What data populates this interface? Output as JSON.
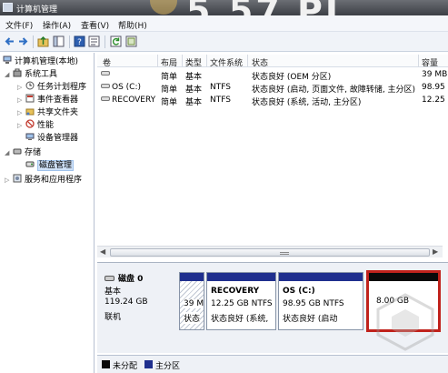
{
  "window": {
    "title": "计算机管理",
    "overlay_clock": "5.57 PI"
  },
  "menu": [
    "文件(F)",
    "操作(A)",
    "查看(V)",
    "帮助(H)"
  ],
  "toolbar_icons": [
    "back-icon",
    "forward-icon",
    "up-folder-icon",
    "show-hide-tree-icon",
    "help-icon",
    "properties-icon",
    "refresh-icon",
    "export-icon"
  ],
  "tree": {
    "root": "计算机管理(本地)",
    "system_tools": "系统工具",
    "task_scheduler": "任务计划程序",
    "event_viewer": "事件查看器",
    "shared_folders": "共享文件夹",
    "performance": "性能",
    "device_manager": "设备管理器",
    "storage": "存储",
    "disk_management": "磁盘管理",
    "services_apps": "服务和应用程序"
  },
  "volumes": {
    "headers": {
      "volume": "卷",
      "layout": "布局",
      "type": "类型",
      "fs": "文件系统",
      "status": "状态",
      "capacity": "容量"
    },
    "rows": [
      {
        "name": "",
        "layout": "简单",
        "type": "基本",
        "fs": "",
        "status": "状态良好 (OEM 分区)",
        "capacity": "39 MB"
      },
      {
        "name": "OS (C:)",
        "layout": "简单",
        "type": "基本",
        "fs": "NTFS",
        "status": "状态良好 (启动, 页面文件, 故障转储, 主分区)",
        "capacity": "98.95 G"
      },
      {
        "name": "RECOVERY",
        "layout": "简单",
        "type": "基本",
        "fs": "NTFS",
        "status": "状态良好 (系统, 活动, 主分区)",
        "capacity": "12.25 G"
      }
    ]
  },
  "disk": {
    "name": "磁盘 0",
    "kind": "基本",
    "size": "119.24 GB",
    "state": "联机",
    "partitions": [
      {
        "name": "",
        "size": "39 M",
        "status": "状态"
      },
      {
        "name": "RECOVERY",
        "size": "12.25 GB NTFS",
        "status": "状态良好 (系统,"
      },
      {
        "name": "OS  (C:)",
        "size": "98.95 GB NTFS",
        "status": "状态良好 (启动"
      },
      {
        "name": "",
        "size": "8.00 GB",
        "status": ""
      }
    ],
    "colors": {
      "primary_bar": "#1f2f8e",
      "unallocated_bar": "#0a0a0a",
      "highlight_border": "#c0221c"
    }
  },
  "legend": [
    {
      "label": "未分配",
      "color": "#0a0a0a"
    },
    {
      "label": "主分区",
      "color": "#1f2f8e"
    }
  ]
}
